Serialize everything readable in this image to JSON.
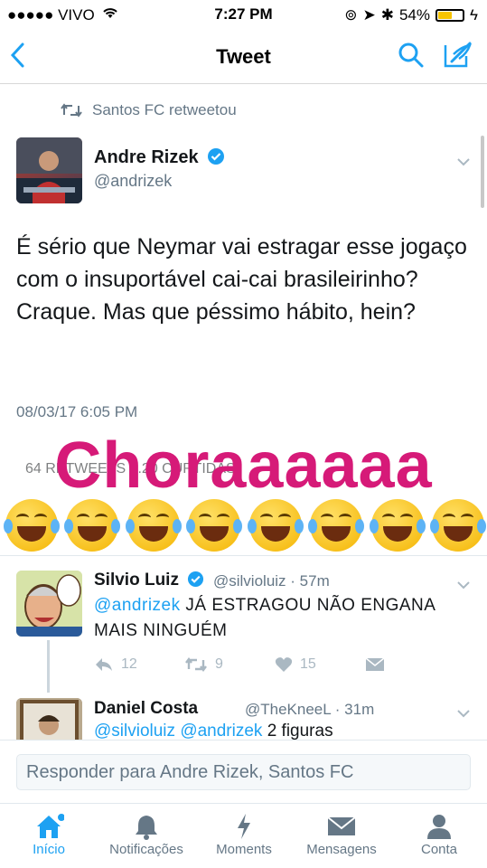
{
  "status": {
    "carrier": "●●●●● VIVO",
    "time": "7:27 PM",
    "battery": "54%"
  },
  "nav": {
    "title": "Tweet"
  },
  "retweet": {
    "label": "Santos FC retweetou"
  },
  "tweet": {
    "name": "Andre Rizek",
    "handle": "@andrizek",
    "text": "É sério que Neymar vai estragar esse jogaço com o insuportável cai-cai brasileirinho? Craque. Mas que péssimo hábito, hein?",
    "date": "08/03/17 6:05 PM",
    "counts": "64 RETWEETS  5.20 CURTIDAS",
    "sticker": "Choraaaaaa",
    "emoji_count": 8
  },
  "reply1": {
    "name": "Silvio Luiz",
    "meta": "@silvioluiz · 57m",
    "mention": "@andrizek",
    "text": " JÁ ESTRAGOU NÃO ENGANA MAIS NINGUÉM",
    "reply_count": "12",
    "retweet_count": "9",
    "like_count": "15"
  },
  "reply2": {
    "name": "Daniel Costa",
    "meta": "@TheKneeL · 31m",
    "mention1": "@silvioluiz",
    "mention2": "@andrizek",
    "text": " 2 figuras"
  },
  "composer": {
    "placeholder": "Responder para Andre Rizek, Santos FC"
  },
  "tabs": [
    {
      "label": "Início"
    },
    {
      "label": "Notificações"
    },
    {
      "label": "Moments"
    },
    {
      "label": "Mensagens"
    },
    {
      "label": "Conta"
    }
  ],
  "colors": {
    "accent": "#1da1f2",
    "sticker": "#d61a78"
  }
}
